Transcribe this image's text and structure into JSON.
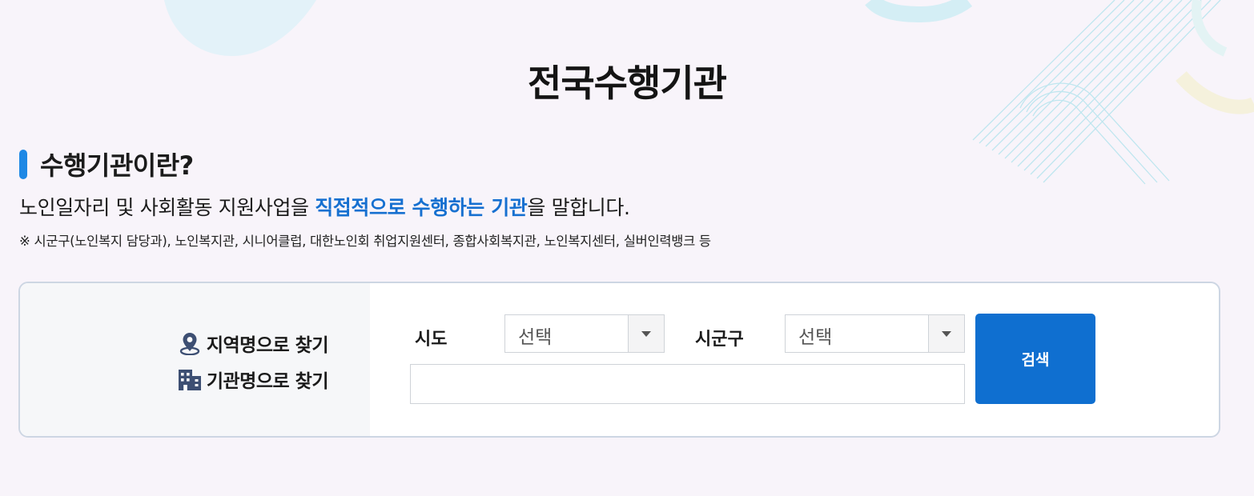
{
  "page_title": "전국수행기관",
  "section": {
    "heading": "수행기관이란?",
    "desc_before": "노인일자리 및 사회활동 지원사업을 ",
    "desc_highlight": "직접적으로 수행하는 기관",
    "desc_after": "을 말합니다.",
    "note": "※ 시군구(노인복지 담당과), 노인복지관, 시니어클럽, 대한노인회 취업지원센터, 종합사회복지관, 노인복지센터, 실버인력뱅크 등"
  },
  "search": {
    "modes": [
      {
        "label": "지역명으로 찾기",
        "icon": "location-pin-icon"
      },
      {
        "label": "기관명으로 찾기",
        "icon": "building-icon"
      }
    ],
    "sido_label": "시도",
    "sido_value": "선택",
    "sigungu_label": "시군구",
    "sigungu_value": "선택",
    "keyword_value": "",
    "button_label": "검색"
  },
  "colors": {
    "background": "#f8f4fa",
    "accent": "#1e88e5",
    "highlight_text": "#1670d0",
    "button": "#0f6fd0",
    "icon": "#3d4f73"
  }
}
